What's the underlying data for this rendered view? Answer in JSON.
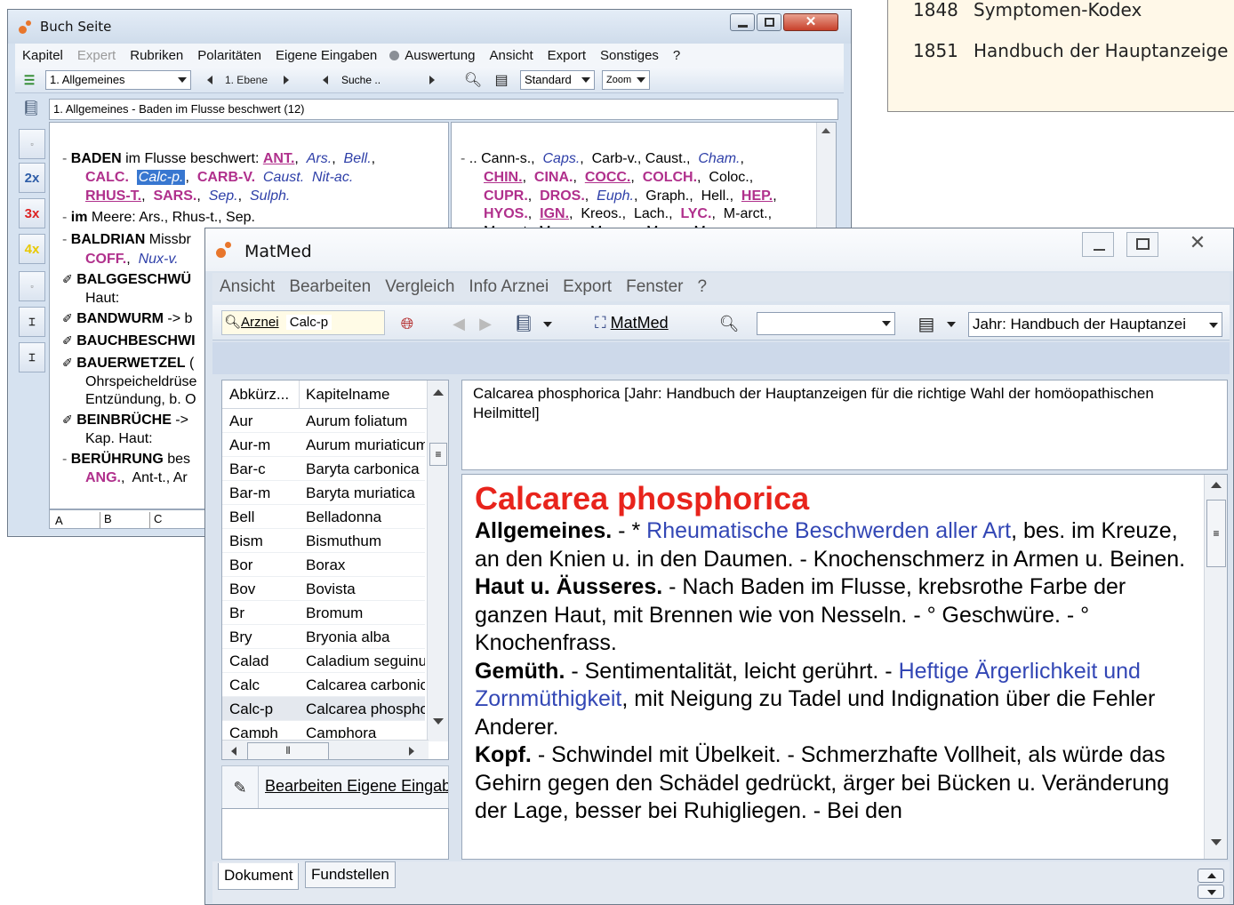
{
  "years_panel": {
    "rows": [
      {
        "year": "1848",
        "title": "Symptomen-Kodex"
      },
      {
        "year": "1851",
        "title": "Handbuch der Hauptanzeige"
      }
    ]
  },
  "buch": {
    "title": "Buch Seite",
    "menu": [
      "Kapitel",
      "Expert",
      "Rubriken",
      "Polaritäten",
      "Eigene Eingaben",
      "Auswertung",
      "Ansicht",
      "Export",
      "Sonstiges",
      "?"
    ],
    "toolbar": {
      "chapter": "1. Allgemeines",
      "level": "1. Ebene",
      "search": "Suche ..",
      "view": "Standard",
      "zoom": "Zoom"
    },
    "path": "1. Allgemeines - Baden im Flusse beschwert (12)",
    "side_buttons": [
      "2x",
      "3x",
      "4x"
    ],
    "left_col": {
      "e1_head": "BADEN",
      "e1_rest": " im Flusse beschwert: ",
      "e1_l1": [
        "ANT.",
        "Ars.",
        "Bell."
      ],
      "e1_l2": [
        "CALC.",
        "Calc-p.",
        "CARB-V.",
        "Caust.",
        "Nit-ac."
      ],
      "e1_l3": [
        "RHUS-T.",
        "SARS.",
        "Sep.",
        "Sulph."
      ],
      "e2_head": "im",
      "e2_rest": " Meere: Ars.,  Rhus-t.,  Sep.",
      "e3_head": "BALDRIAN",
      "e3_rest": " Missbr",
      "e3_l2a": "COFF.",
      "e3_l2b": "Nux-v.",
      "e4_head": "BALGGESCHWÜ",
      "e4_l2": "Haut:",
      "e5_head": "BANDWURM",
      "e5_rest": " -> b",
      "e6_head": "BAUCHBESCHWI",
      "e7_head": "BAUERWETZEL",
      "e7_rest": " (",
      "e7_l2": "Ohrspeicheldrüse",
      "e7_l3": "Entzündung, b. O",
      "e8_head": "BEINBRÜCHE",
      "e8_rest": " ->",
      "e8_l2": "Kap. Haut:",
      "e9_head": "BERÜHRUNG",
      "e9_rest": " bes",
      "e9_l2a": "ANG.",
      "e9_l2b": "Ant-t.,  Ar"
    },
    "right_col": {
      "l1_plain": ".. Cann-s.,",
      "l1_a": "Caps.",
      "l1_b": "Carb-v.,  Caust.,",
      "l1_c": "Cham.",
      "l2": [
        "CHIN.",
        "CINA.",
        "COCC.",
        "COLCH.",
        "Coloc."
      ],
      "l3": [
        "CUPR.",
        "DROS.",
        "Euph.",
        "Graph.",
        "Hell.",
        "HEP."
      ],
      "l4": [
        "HYOS.",
        "IGN.",
        "Kreos.",
        "Lach.",
        "LYC.",
        "M-arct."
      ],
      "l5": "M-aust.,  Mag-c.,  Mag-m.,  Mang.,  Merc."
    },
    "alpha_tabs": [
      "A",
      "B",
      "C"
    ]
  },
  "matmed": {
    "title": "MatMed",
    "menu": [
      "Ansicht",
      "Bearbeiten",
      "Vergleich",
      "Info Arznei",
      "Export",
      "Fenster",
      "?"
    ],
    "toolbar": {
      "arznei_label": "Arznei",
      "arznei_value": "Calc-p",
      "matmed_button": "MatMed",
      "year_combo": "Jahr: Handbuch der Hauptanzei"
    },
    "list_headers": [
      "Abkürz...",
      "Kapitelname"
    ],
    "list": [
      [
        "Aur",
        "Aurum foliatum"
      ],
      [
        "Aur-m",
        "Aurum muriaticum"
      ],
      [
        "Bar-c",
        "Baryta carbonica"
      ],
      [
        "Bar-m",
        "Baryta muriatica"
      ],
      [
        "Bell",
        "Belladonna"
      ],
      [
        "Bism",
        "Bismuthum"
      ],
      [
        "Bor",
        "Borax"
      ],
      [
        "Bov",
        "Bovista"
      ],
      [
        "Br",
        "Bromum"
      ],
      [
        "Bry",
        "Bryonia alba"
      ],
      [
        "Calad",
        "Caladium seguinum"
      ],
      [
        "Calc",
        "Calcarea carbonica"
      ],
      [
        "Calc-p",
        "Calcarea phosphorica"
      ],
      [
        "Camph",
        "Camphora"
      ]
    ],
    "selected_index": 12,
    "edit_button": "Bearbeiten Eigene Eingaben",
    "header_text": "Calcarea phosphorica [Jahr: Handbuch der Hauptanzeigen für die richtige Wahl der homöopathischen Heilmittel]",
    "doc": {
      "title": "Calcarea phosphorica",
      "p1_head": "Allgemeines.",
      "p1_pre": " - * ",
      "p1_link": "Rheumatische Beschwerden aller Art",
      "p1_rest": ", bes. im Kreuze, an den Knien u. in den Daumen. - Knochenschmerz in Armen u. Beinen.",
      "p2_head": "Haut u. Äusseres.",
      "p2_rest": " - Nach Baden im Flusse, krebsrothe Farbe der ganzen Haut, mit Brennen wie von Nesseln. - ° Geschwüre. - ° Knochenfrass.",
      "p3_head": "Gemüth.",
      "p3_pre": " - Sentimentalität, leicht gerührt. - ",
      "p3_link": "Heftige Ärgerlichkeit und Zornmüthigkeit",
      "p3_rest": ", mit Neigung zu Tadel und Indignation über die Fehler Anderer.",
      "p4_head": "Kopf.",
      "p4_rest": " - Schwindel mit Übelkeit. - Schmerzhafte Vollheit, als würde das Gehirn gegen den Schädel gedrückt, ärger bei Bücken u. Veränderung der Lage, besser bei Ruhigliegen. - Bei den"
    },
    "tabs": [
      "Dokument",
      "Fundstellen"
    ]
  },
  "colors": {
    "accent_red": "#e8241c",
    "link_blue": "#3347b5",
    "magenta": "#b0308c"
  }
}
